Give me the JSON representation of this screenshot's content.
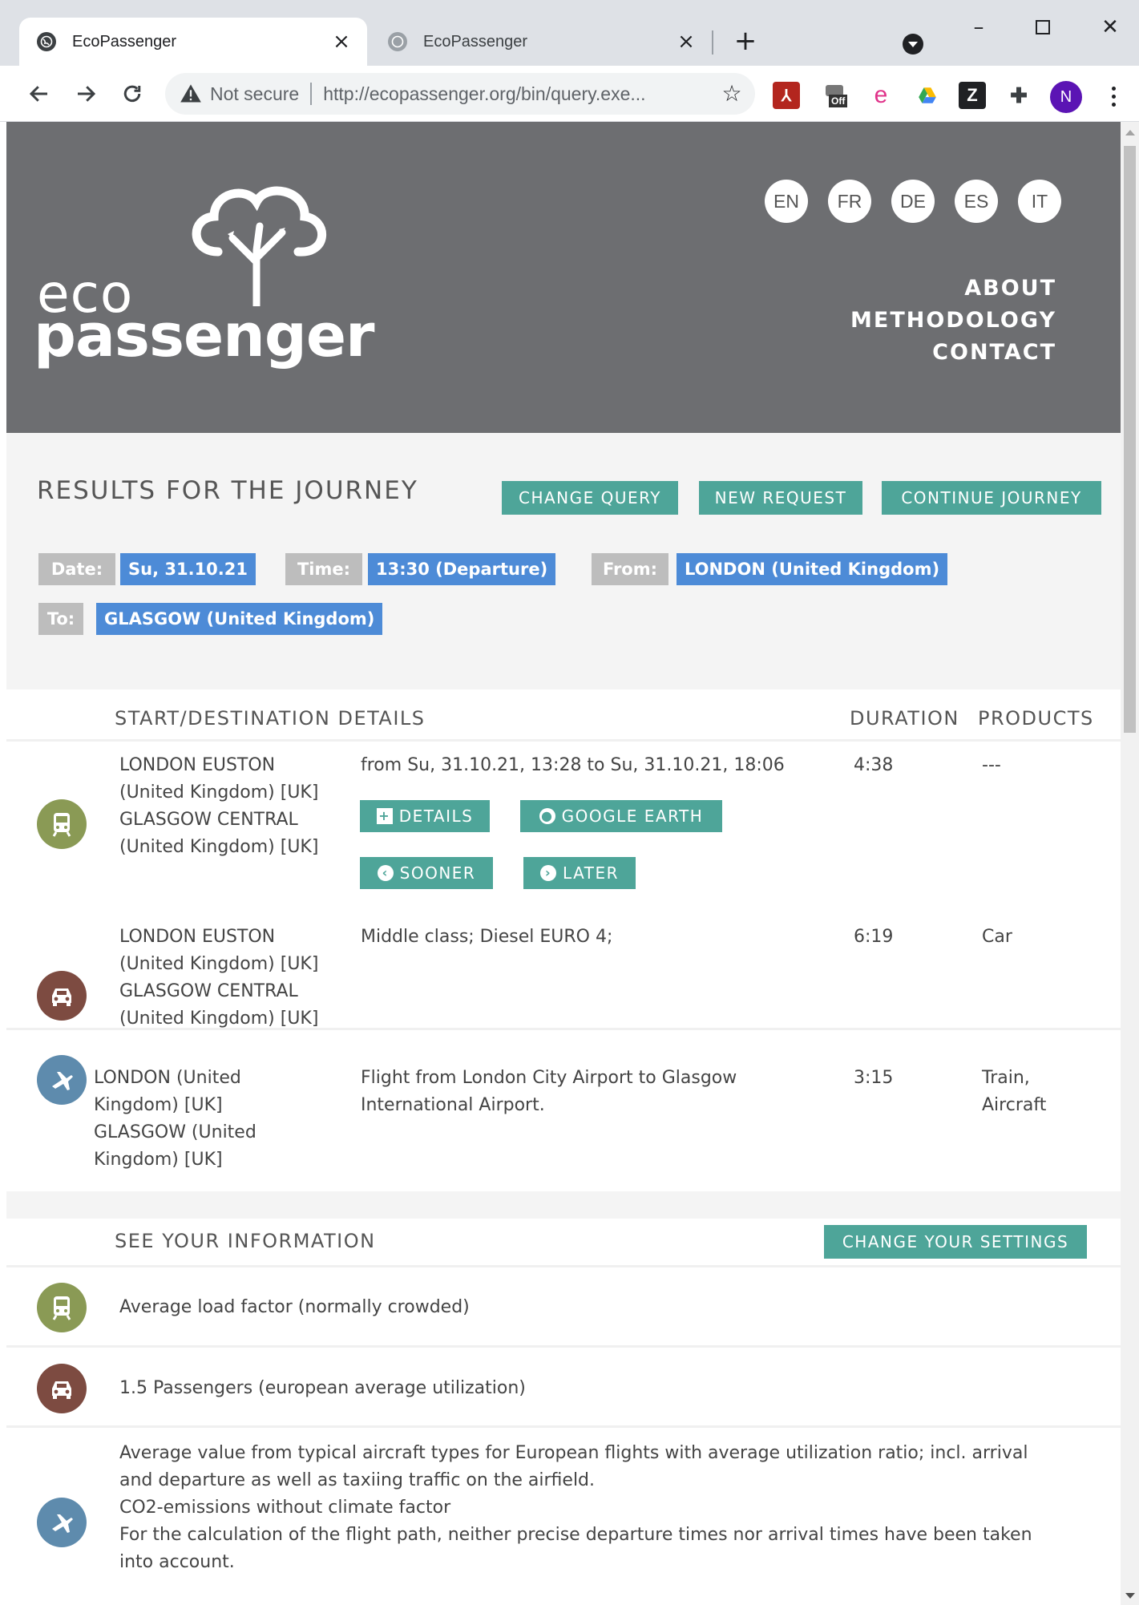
{
  "browser": {
    "tabs": [
      {
        "title": "EcoPassenger",
        "active": true
      },
      {
        "title": "EcoPassenger",
        "active": false
      }
    ],
    "security_label": "Not secure",
    "url": "http://ecopassenger.org/bin/query.exe...",
    "profile_initial": "N",
    "extensions": [
      "pdf-icon",
      "off-toggle-icon",
      "edge-icon",
      "drive-icon",
      "zotero-icon",
      "puzzle-icon"
    ],
    "extension_off_label": "Off",
    "extension_zotero_label": "Z"
  },
  "header": {
    "logo_line1": "eco",
    "logo_line2": "passenger",
    "languages": [
      "EN",
      "FR",
      "DE",
      "ES",
      "IT"
    ],
    "nav": [
      "ABOUT",
      "METHODOLOGY",
      "CONTACT"
    ]
  },
  "query": {
    "title": "RESULTS FOR THE JOURNEY",
    "buttons": {
      "change_query": "CHANGE QUERY",
      "new_request": "NEW REQUEST",
      "continue_journey": "CONTINUE JOURNEY"
    },
    "fields": {
      "date_label": "Date:",
      "date_value": "Su, 31.10.21",
      "time_label": "Time:",
      "time_value": "13:30 (Departure)",
      "from_label": "From:",
      "from_value": "LONDON (United Kingdom)",
      "to_label": "To:",
      "to_value": "GLASGOW (United Kingdom)"
    }
  },
  "results": {
    "columns": [
      "START/DESTINATION DETAILS",
      "DURATION",
      "PRODUCTS"
    ],
    "rows": [
      {
        "mode": "train",
        "stations": [
          "LONDON EUSTON",
          "(United Kingdom) [UK]",
          "GLASGOW CENTRAL",
          "(United Kingdom) [UK]"
        ],
        "details": "from Su, 31.10.21, 13:28 to Su, 31.10.21, 18:06",
        "duration": "4:38",
        "products": "---",
        "actions": {
          "details": "DETAILS",
          "google_earth": "GOOGLE EARTH",
          "sooner": "SOONER",
          "later": "LATER"
        }
      },
      {
        "mode": "car",
        "stations": [
          "LONDON EUSTON",
          "(United Kingdom) [UK]",
          "GLASGOW CENTRAL",
          "(United Kingdom) [UK]"
        ],
        "details": "Middle class; Diesel EURO 4;",
        "duration": "6:19",
        "products": "Car"
      },
      {
        "mode": "plane",
        "stations": [
          "LONDON (United",
          "Kingdom) [UK]",
          "GLASGOW (United",
          "Kingdom) [UK]"
        ],
        "details": [
          "Flight from London City Airport to Glasgow",
          "International Airport."
        ],
        "duration": "3:15",
        "products": [
          "Train,",
          "Aircraft"
        ]
      }
    ]
  },
  "info": {
    "title": "SEE YOUR INFORMATION",
    "change_settings": "CHANGE YOUR SETTINGS",
    "train": "Average load factor (normally crowded)",
    "car": "1.5 Passengers (european average utilization)",
    "plane": [
      "Average value from typical aircraft types for European flights with average utilization ratio; incl. arrival",
      "and departure as well as taxiing traffic on the airfield.",
      "CO2-emissions without climate factor",
      "For the calculation of the flight path, neither precise departure times nor arrival times have been taken",
      "into account."
    ]
  },
  "colors": {
    "header_bg": "#6d6e71",
    "teal": "#4ea599",
    "chip_blue": "#4d8bd7",
    "chip_grey": "#bdbdbd",
    "train": "#8a9a55",
    "car": "#7d4b41",
    "plane": "#5e8bad"
  }
}
